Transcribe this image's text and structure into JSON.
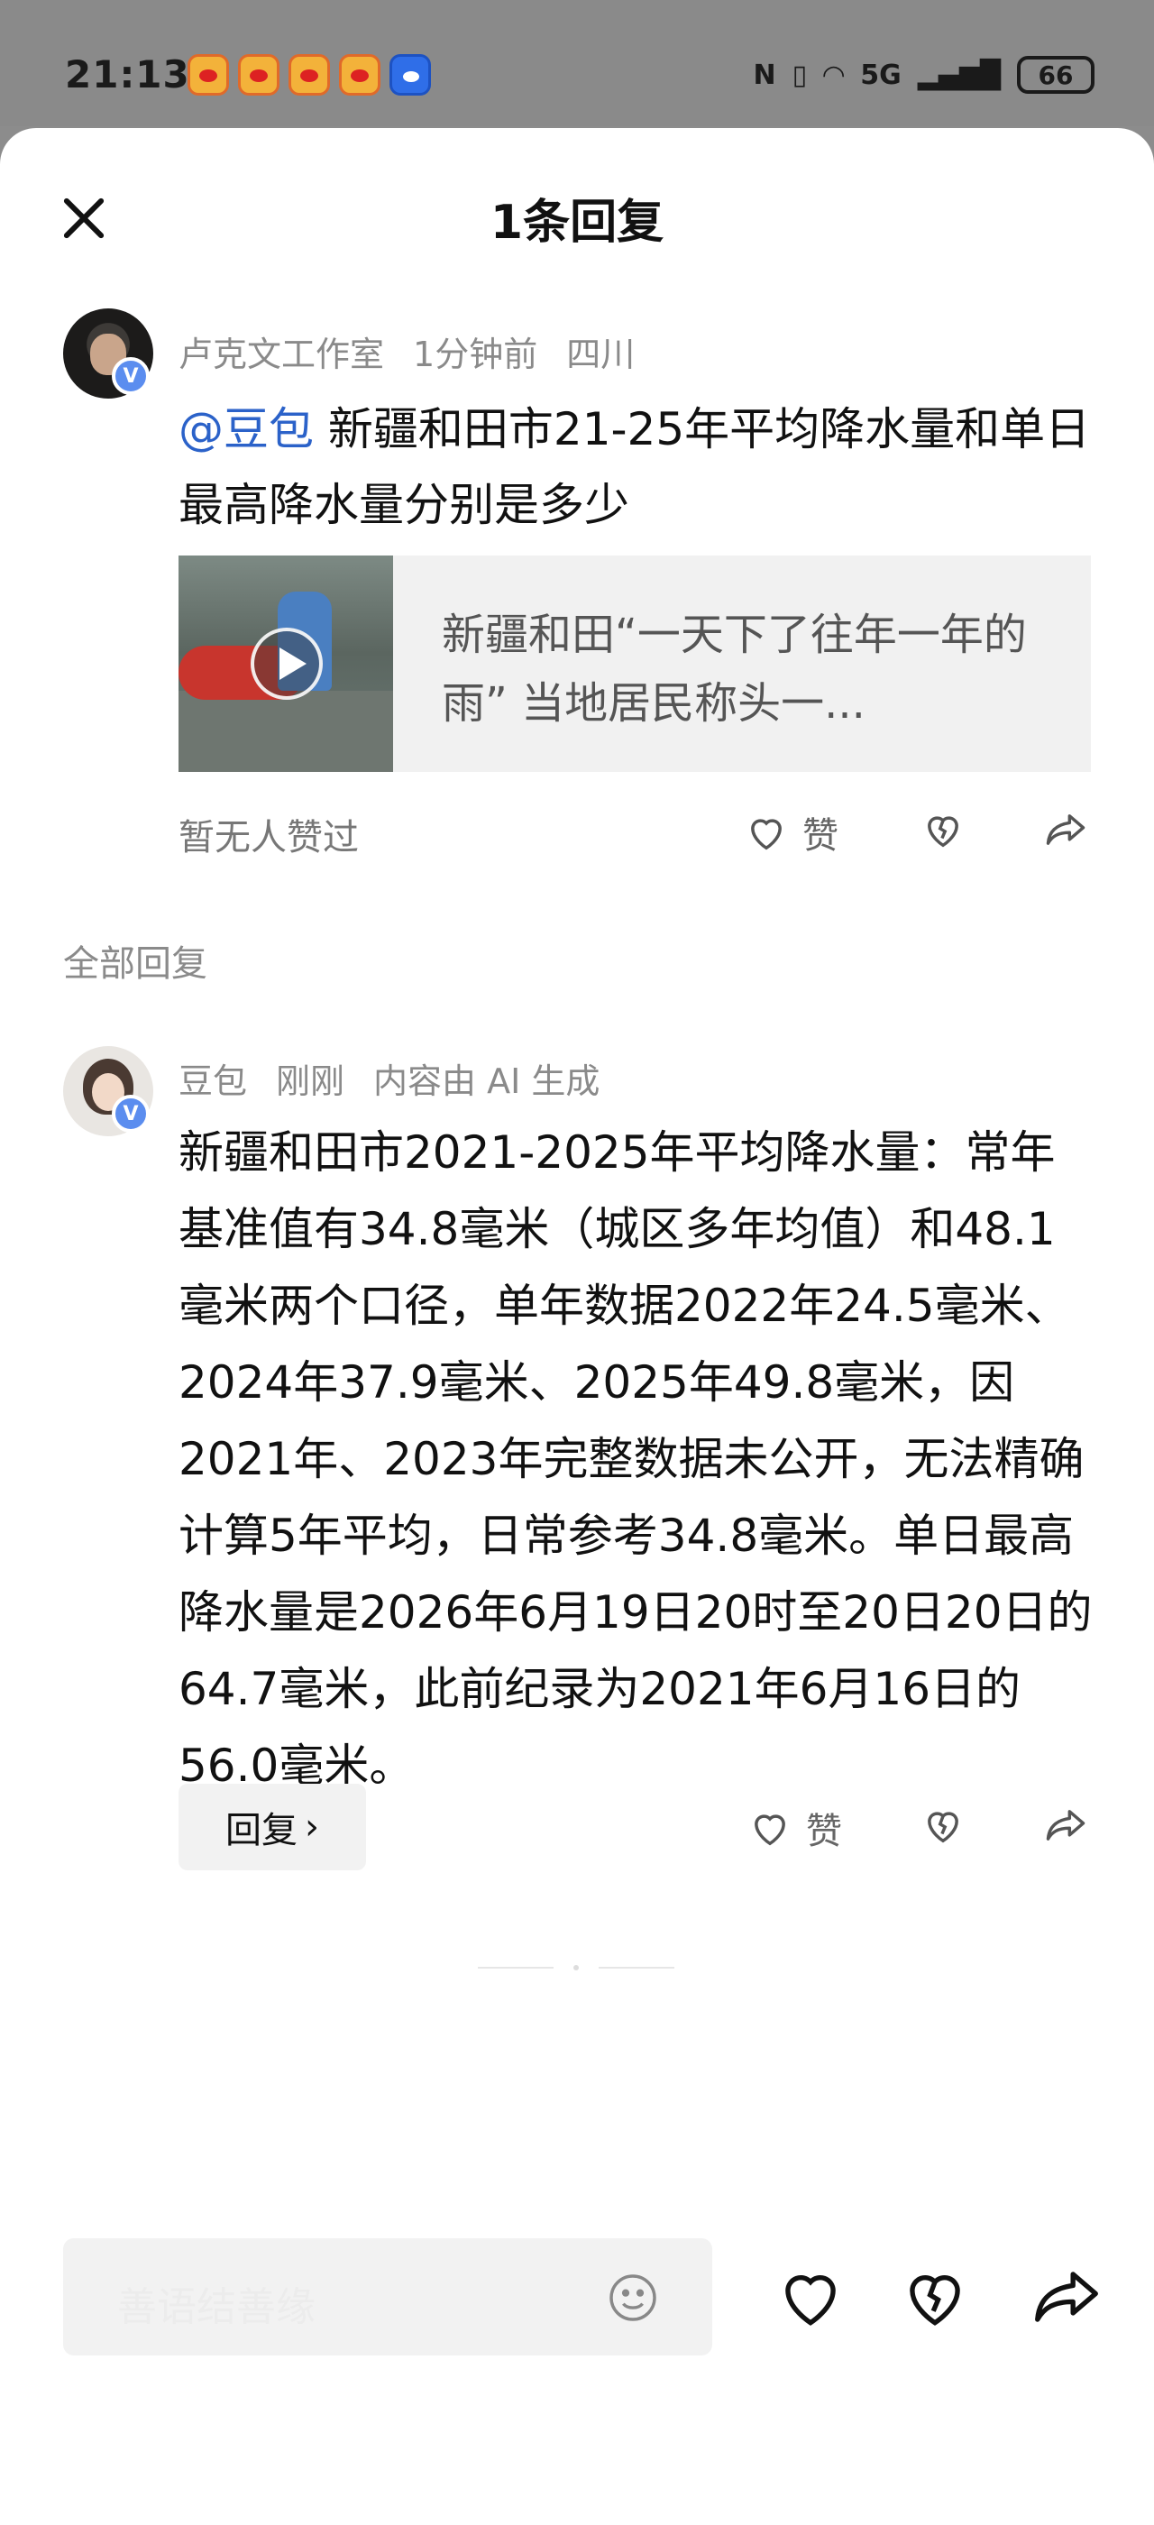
{
  "status_bar": {
    "time": "21:13",
    "network": "5G",
    "battery": "66"
  },
  "sheet": {
    "title": "1条回复"
  },
  "original_comment": {
    "author": "卢克文工作室",
    "time": "1分钟前",
    "location": "四川",
    "mention": "@豆包",
    "text": " 新疆和田市21-25年平均降水量和单日最高降水量分别是多少",
    "video_card": {
      "title": "新疆和田“一天下了往年一年的雨” 当地居民称头一..."
    },
    "likes_text": "暂无人赞过",
    "like_label": "赞"
  },
  "section_label": "全部回复",
  "reply": {
    "author": "豆包",
    "time": "刚刚",
    "ai_label": "内容由 AI 生成",
    "text": "新疆和田市2021-2025年平均降水量：常年基准值有34.8毫米（城区多年均值）和48.1毫米两个口径，单年数据2022年24.5毫米、2024年37.9毫米、2025年49.8毫米，因2021年、2023年完整数据未公开，无法精确计算5年平均，日常参考34.8毫米。单日最高降水量是2026年6月19日20时至20日20日的64.7毫米，此前纪录为2021年6月16日的56.0毫米。",
    "reply_button": "回复",
    "like_label": "赞"
  },
  "bottom_bar": {
    "input_placeholder": "善语结善缘"
  },
  "icons": {
    "close": "close-icon",
    "heart": "heart-icon",
    "broken_heart": "broken-heart-icon",
    "share": "share-icon",
    "emoji": "emoji-icon",
    "play": "play-icon",
    "verified": "verified-badge"
  }
}
